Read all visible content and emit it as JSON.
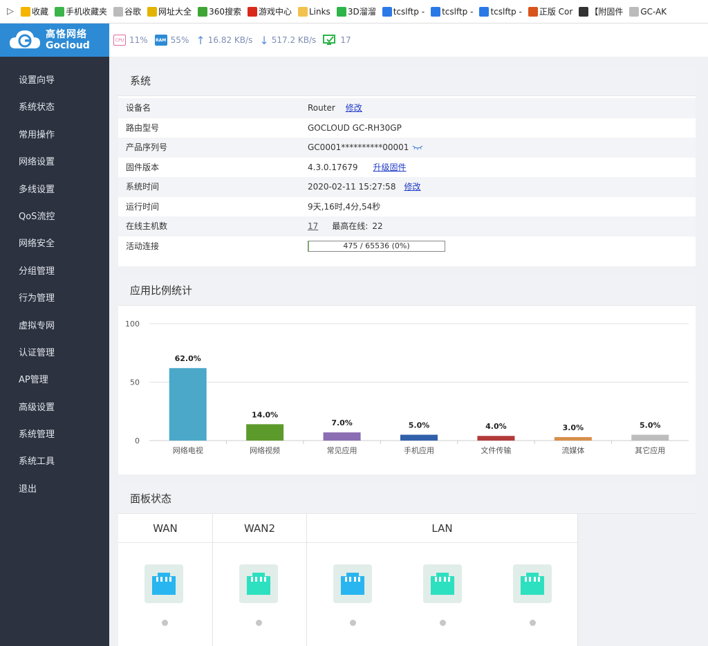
{
  "bookmarks": {
    "items": [
      {
        "label": "收藏",
        "icon": "star-icon",
        "color": "#f4b400"
      },
      {
        "label": "手机收藏夹",
        "icon": "phone-icon",
        "color": "#3bb54a"
      },
      {
        "label": "谷歌",
        "icon": "page-icon",
        "color": "#bbbbbb"
      },
      {
        "label": "网址大全",
        "icon": "globe-icon",
        "color": "#e2b400"
      },
      {
        "label": "360搜索",
        "icon": "search-icon",
        "color": "#3fa535"
      },
      {
        "label": "游戏中心",
        "icon": "game-icon",
        "color": "#d9281c"
      },
      {
        "label": "Links",
        "icon": "folder-icon",
        "color": "#f2c14e"
      },
      {
        "label": "3D溜溜",
        "icon": "chat-icon",
        "color": "#2db44a"
      },
      {
        "label": "tcslftp -",
        "icon": "k-icon",
        "color": "#2a79e6"
      },
      {
        "label": "tcslftp -",
        "icon": "k-icon",
        "color": "#2a79e6"
      },
      {
        "label": "tcslftp -",
        "icon": "k-icon",
        "color": "#2a79e6"
      },
      {
        "label": "正版 Cor",
        "icon": "jian-icon",
        "color": "#d9541c"
      },
      {
        "label": "【附固件",
        "icon": "image-icon",
        "color": "#333333"
      },
      {
        "label": "GC-AK",
        "icon": "page-icon",
        "color": "#bbbbbb"
      }
    ]
  },
  "header": {
    "logo_cn": "高恪网络",
    "logo_en": "Gocloud",
    "brand_color": "#2d8bd5",
    "cpu_label": "CPU",
    "cpu": "11%",
    "ram_label": "RAM",
    "ram": "55%",
    "upload": "16.82 KB/s",
    "download": "517.2 KB/s",
    "online": "17"
  },
  "sidebar": {
    "items": [
      "设置向导",
      "系统状态",
      "常用操作",
      "网络设置",
      "多线设置",
      "QoS流控",
      "网络安全",
      "分组管理",
      "行为管理",
      "虚拟专网",
      "认证管理",
      "AP管理",
      "高级设置",
      "系统管理",
      "系统工具",
      "退出"
    ]
  },
  "system": {
    "title": "系统",
    "device_name_label": "设备名",
    "device_name": "Router",
    "device_name_link": "修改",
    "model_label": "路由型号",
    "model": "GOCLOUD GC-RH30GP",
    "serial_label": "产品序列号",
    "serial": "GC0001**********00001",
    "firmware_label": "固件版本",
    "firmware": "4.3.0.17679",
    "firmware_link": "升级固件",
    "time_label": "系统时间",
    "time": "2020-02-11 15:27:58",
    "time_link": "修改",
    "uptime_label": "运行时间",
    "uptime": "9天,16时,4分,54秒",
    "hosts_label": "在线主机数",
    "hosts": "17",
    "max_online_label": "最高在线:",
    "max_online": "22",
    "conn_label": "活动连接",
    "conn_text": "475 / 65536 (0%)",
    "conn_fraction": 0.0072
  },
  "app_stats": {
    "title": "应用比例统计"
  },
  "chart_data": {
    "type": "bar",
    "categories": [
      "网络电视",
      "网络视频",
      "常见应用",
      "手机应用",
      "文件传输",
      "流媒体",
      "其它应用"
    ],
    "values": [
      62.0,
      14.0,
      7.0,
      5.0,
      4.0,
      3.0,
      5.0
    ],
    "data_labels": [
      "62.0%",
      "14.0%",
      "7.0%",
      "5.0%",
      "4.0%",
      "3.0%",
      "5.0%"
    ],
    "colors": [
      "#4ba8c9",
      "#5d9a2c",
      "#8a6db3",
      "#3160aa",
      "#b33a3a",
      "#d98f4a",
      "#bdbdbd"
    ],
    "yticks": [
      "0",
      "50",
      "100"
    ],
    "ylim": [
      0,
      100
    ],
    "grid": true
  },
  "ports": {
    "title": "面板状态",
    "wan": "WAN",
    "wan2": "WAN2",
    "lan": "LAN",
    "active_color": "#29b5f0",
    "idle_color": "#2de0c0"
  }
}
